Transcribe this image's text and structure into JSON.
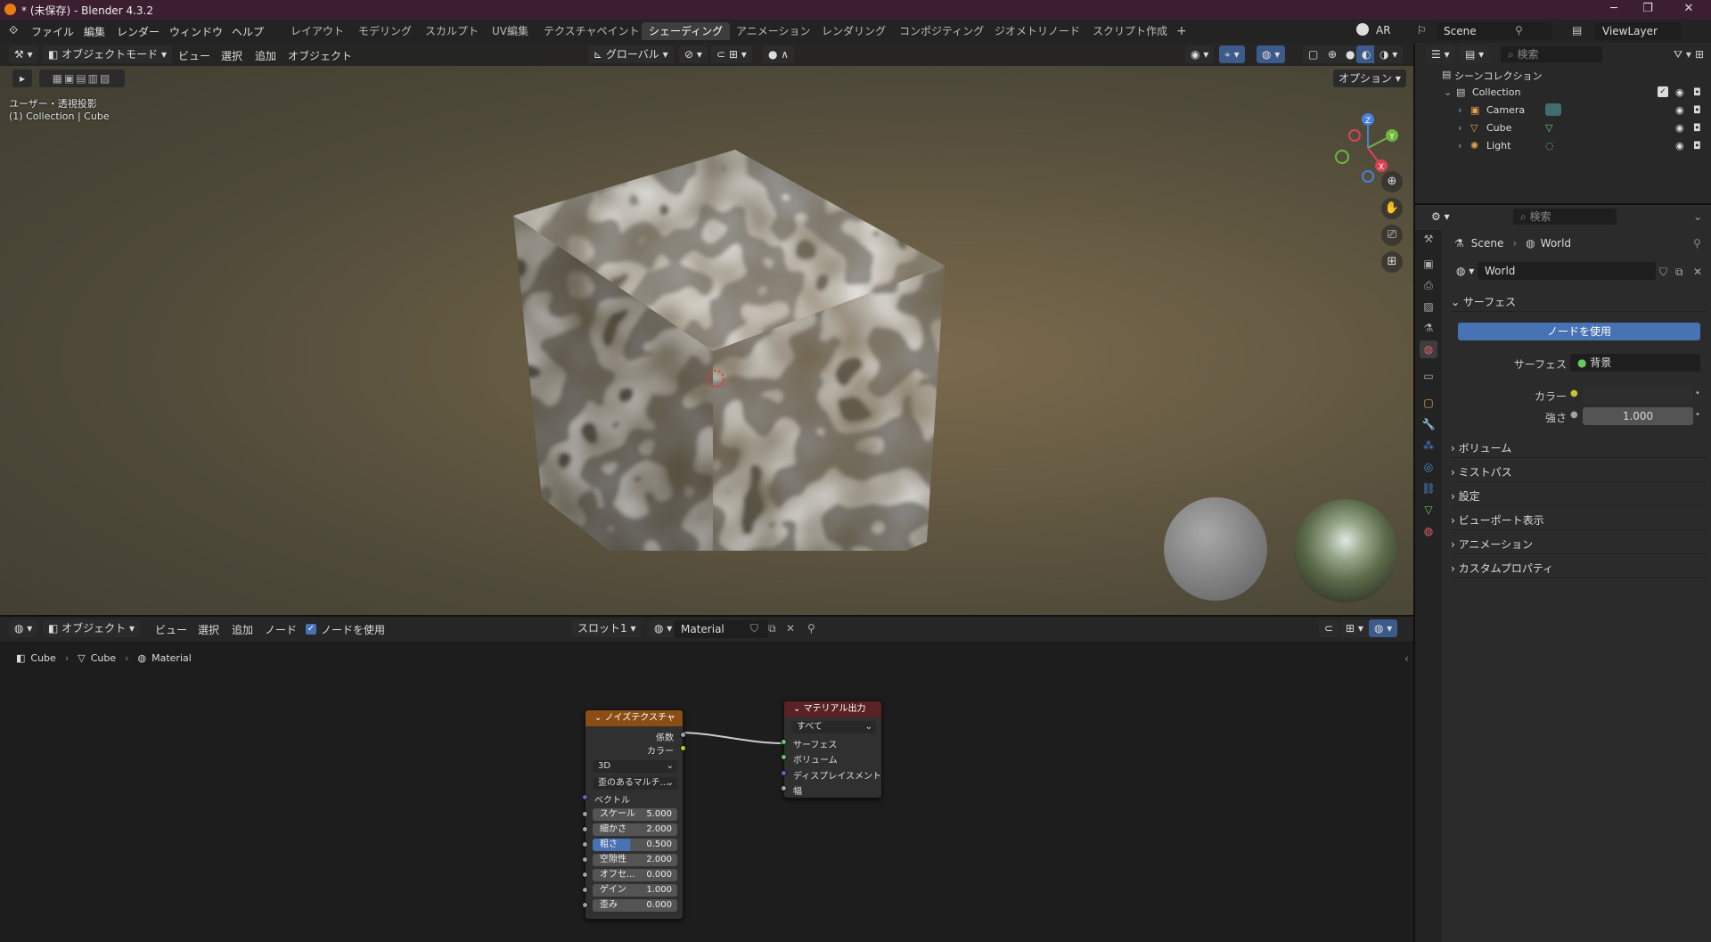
{
  "window": {
    "title": "* (未保存) - Blender 4.3.2",
    "minimize": "─",
    "restore": "❐",
    "close": "✕"
  },
  "menubar": {
    "items": [
      "ファイル",
      "編集",
      "レンダー",
      "ウィンドウ",
      "ヘルプ"
    ],
    "workspaces": [
      "レイアウト",
      "モデリング",
      "スカルプト",
      "UV編集",
      "テクスチャペイント",
      "シェーディング",
      "アニメーション",
      "レンダリング",
      "コンポジティング",
      "ジオメトリノード",
      "スクリプト作成"
    ],
    "active_workspace": "シェーディング",
    "add_tab": "+",
    "ar_label": "AR",
    "scene": "Scene",
    "viewlayer": "ViewLayer"
  },
  "viewport": {
    "mode": "オブジェクトモード",
    "menus": [
      "ビュー",
      "選択",
      "追加",
      "オブジェクト"
    ],
    "transform": "グローバル",
    "options": "オプション",
    "view_label": "ユーザー・透視投影",
    "collection_label": "(1) Collection | Cube",
    "axis_labels": {
      "x": "X",
      "y": "Y",
      "z": "Z"
    }
  },
  "node_editor": {
    "mode": "オブジェクト",
    "menus": [
      "ビュー",
      "選択",
      "追加",
      "ノード"
    ],
    "use_nodes": "ノードを使用",
    "slot": "スロット1",
    "material": "Material",
    "breadcrumb": [
      "Cube",
      "Cube",
      "Material"
    ],
    "noise_node": {
      "title": "ノイズテクスチャ",
      "outputs": [
        "係数",
        "カラー"
      ],
      "dimension": "3D",
      "type": "歪のあるマルチ...",
      "vector": "ベクトル",
      "fields": [
        {
          "label": "スケール",
          "value": "5.000"
        },
        {
          "label": "細かさ",
          "value": "2.000"
        },
        {
          "label": "粗さ",
          "value": "0.500"
        },
        {
          "label": "空隙性",
          "value": "2.000"
        },
        {
          "label": "オフセ...",
          "value": "0.000"
        },
        {
          "label": "ゲイン",
          "value": "1.000"
        },
        {
          "label": "歪み",
          "value": "0.000"
        }
      ]
    },
    "output_node": {
      "title": "マテリアル出力",
      "target": "すべて",
      "inputs": [
        "サーフェス",
        "ボリューム",
        "ディスプレイスメント",
        "幅"
      ]
    }
  },
  "outliner": {
    "search_placeholder": "検索",
    "scene_collection": "シーンコレクション",
    "collection": "Collection",
    "items": [
      "Camera",
      "Cube",
      "Light"
    ]
  },
  "properties": {
    "search_placeholder": "検索",
    "breadcrumb": [
      "Scene",
      "World"
    ],
    "world_name": "World",
    "surface_section": "サーフェス",
    "use_nodes_button": "ノードを使用",
    "surface_label": "サーフェス",
    "surface_value": "背景",
    "color_label": "カラー",
    "strength_label": "強さ",
    "strength_value": "1.000",
    "sections": [
      "ボリューム",
      "ミストパス",
      "設定",
      "ビューポート表示",
      "アニメーション",
      "カスタムプロパティ"
    ]
  }
}
